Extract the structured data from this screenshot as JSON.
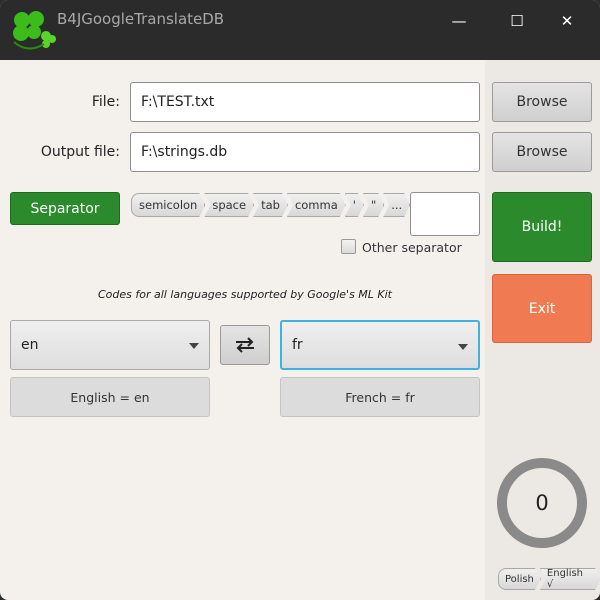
{
  "window": {
    "title": "B4JGoogleTranslateDB",
    "minimize": "—",
    "maximize": "☐",
    "close": "✕"
  },
  "file": {
    "label": "File:",
    "value": "F:\\TEST.txt",
    "browse": "Browse"
  },
  "output": {
    "label": "Output file:",
    "value": "F:\\strings.db",
    "browse": "Browse"
  },
  "separator": {
    "button": "Separator",
    "options": [
      "semicolon",
      "space",
      "tab",
      "comma",
      "'",
      "\"",
      "..."
    ],
    "other_label": "Other separator",
    "other_value": ""
  },
  "build": "Build!",
  "exit": "Exit",
  "info": "Codes for all languages supported by Google's ML Kit",
  "source": {
    "code": "en",
    "name": "English = en"
  },
  "swap_icon": "swap-arrows",
  "target": {
    "code": "fr",
    "name": "French = fr"
  },
  "counter": {
    "value": "0"
  },
  "lang_crumbs": [
    "Polish",
    "English √"
  ],
  "colors": {
    "green": "#2b8a2b",
    "exit": "#f07b52",
    "titlebar": "#2b2b2b"
  }
}
